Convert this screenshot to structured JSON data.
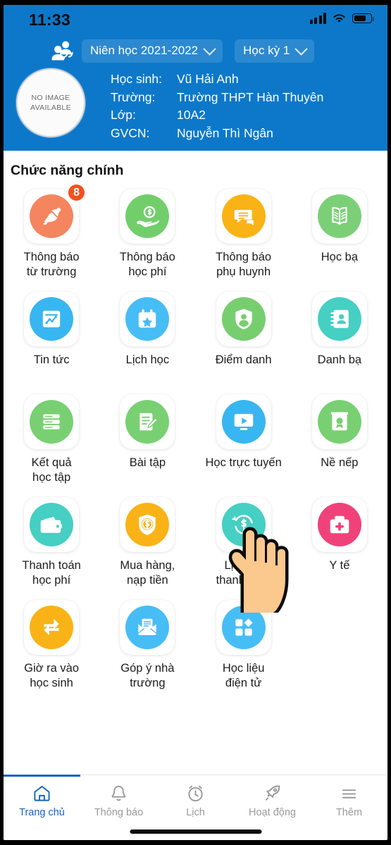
{
  "status_bar": {
    "time": "11:33",
    "signal_icon": "cellular-bars-icon",
    "wifi_icon": "wifi-icon",
    "battery_icon": "battery-icon"
  },
  "header": {
    "background_color": "#0D78C9",
    "switch_account_icon": "switch-user-icon",
    "year_dropdown": {
      "label": "Niên học 2021-2022",
      "chevron": "chevron-down-icon"
    },
    "term_dropdown": {
      "label": "Học kỳ 1",
      "chevron": "chevron-down-icon"
    },
    "avatar": {
      "line1": "NO IMAGE",
      "line2": "AVAILABLE"
    },
    "info": [
      {
        "label": "Học sinh:",
        "value": "Vũ Hải Anh"
      },
      {
        "label": "Trường:",
        "value": "Trường THPT  Hàn Thuyên"
      },
      {
        "label": "Lớp:",
        "value": "10A2"
      },
      {
        "label": "GVCN:",
        "value": "Nguyễn Thì Ngân"
      }
    ]
  },
  "main": {
    "section_title": "Chức năng chính",
    "items": [
      {
        "label": "Thông báo\ntừ trường",
        "icon": "bell-icon",
        "color": "#F5855F",
        "badge": "8"
      },
      {
        "label": "Thông báo\nhọc phí",
        "icon": "hand-money-icon",
        "color": "#72CE6B",
        "badge": ""
      },
      {
        "label": "Thông báo\nphụ huynh",
        "icon": "chat-bubble-icon",
        "color": "#F9B316",
        "badge": ""
      },
      {
        "label": "Học bạ",
        "icon": "open-book-icon",
        "color": "#7BD077",
        "badge": ""
      },
      {
        "label": "Tin tức",
        "icon": "news-chart-icon",
        "color": "#38B6F1",
        "badge": ""
      },
      {
        "label": "Lịch học",
        "icon": "calendar-star-icon",
        "color": "#47BDF5",
        "badge": ""
      },
      {
        "label": "Điểm danh",
        "icon": "shield-user-icon",
        "color": "#77CE6F",
        "badge": ""
      },
      {
        "label": "Danh bạ",
        "icon": "contact-book-icon",
        "color": "#46CFC3",
        "badge": ""
      },
      {
        "label": "Kết quả\nhọc tập",
        "icon": "results-list-icon",
        "color": "#79D072",
        "badge": ""
      },
      {
        "label": "Bài tập",
        "icon": "homework-edit-icon",
        "color": "#79D072",
        "badge": ""
      },
      {
        "label": "Học trực tuyến",
        "icon": "online-class-icon",
        "color": "#38B6F1",
        "badge": ""
      },
      {
        "label": "Nề nếp",
        "icon": "conduct-award-icon",
        "color": "#79D072",
        "badge": ""
      },
      {
        "label": "Thanh toán\nhọc phí",
        "icon": "wallet-icon",
        "color": "#46CFC3",
        "badge": ""
      },
      {
        "label": "Mua hàng,\nnạp tiền",
        "icon": "shield-money-icon",
        "color": "#F9B316",
        "badge": ""
      },
      {
        "label": "Lịch sử\nthanh toán",
        "icon": "payment-history-icon",
        "color": "#46CFC3",
        "badge": ""
      },
      {
        "label": "Y tế",
        "icon": "medical-kit-icon",
        "color": "#F0427A",
        "badge": ""
      },
      {
        "label": "Giờ ra vào\nhọc sinh",
        "icon": "in-out-arrows-icon",
        "color": "#F9B316",
        "badge": ""
      },
      {
        "label": "Góp ý nhà\ntrường",
        "icon": "envelope-icon",
        "color": "#47BDF5",
        "badge": ""
      },
      {
        "label": "Học liệu\nđiện tử",
        "icon": "grid-blocks-icon",
        "color": "#47BDF5",
        "badge": ""
      }
    ],
    "cursor_icon": "pointing-hand-cursor"
  },
  "tabbar": {
    "active_color": "#1565C0",
    "inactive_color": "#9a9a9a",
    "tabs": [
      {
        "label": "Trang chủ",
        "icon": "home-icon",
        "active": true
      },
      {
        "label": "Thông báo",
        "icon": "bell-icon",
        "active": false
      },
      {
        "label": "Lịch",
        "icon": "clock-icon",
        "active": false
      },
      {
        "label": "Hoạt động",
        "icon": "rocket-icon",
        "active": false
      },
      {
        "label": "Thêm",
        "icon": "hamburger-icon",
        "active": false
      }
    ]
  }
}
